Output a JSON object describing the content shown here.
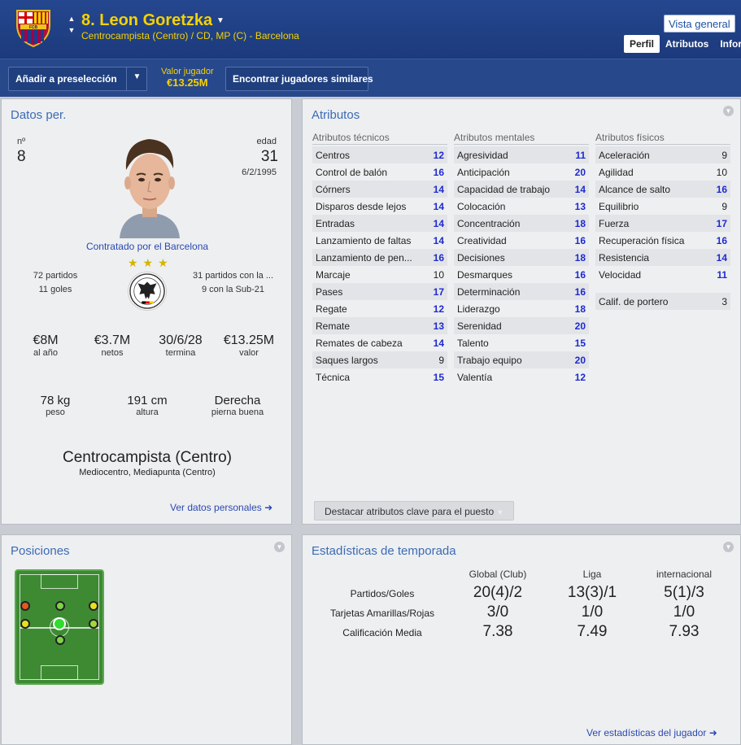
{
  "header": {
    "player_title": "8. Leon Goretzka",
    "subtitle": "Centrocampista (Centro) / CD, MP (C) - Barcelona",
    "overview_button": "Vista general",
    "tabs": [
      "Perfil",
      "Atributos",
      "Infor"
    ],
    "crest_text": "FCB"
  },
  "toolbar": {
    "shortlist_button": "Añadir a preselección",
    "value_label": "Valor jugador",
    "value_amount": "€13.25M",
    "similar_button": "Encontrar jugadores similares"
  },
  "personal": {
    "title": "Datos per.",
    "number_label": "nº",
    "number": "8",
    "age_label": "edad",
    "age": "31",
    "dob": "6/2/1995",
    "contract": "Contratado por el Barcelona",
    "club_apps": "72 partidos",
    "club_goals": "11 goles",
    "intl_apps": "31 partidos con la ...",
    "intl_u21": "9 con la Sub-21",
    "wage": "€8M",
    "wage_label": "al año",
    "net": "€3.7M",
    "net_label": "netos",
    "expiry": "30/6/28",
    "expiry_label": "termina",
    "value": "€13.25M",
    "value_label": "valor",
    "weight": "78 kg",
    "weight_label": "peso",
    "height": "191 cm",
    "height_label": "altura",
    "foot": "Derecha",
    "foot_label": "pierna buena",
    "position": "Centrocampista (Centro)",
    "position_sub": "Mediocentro, Mediapunta (Centro)",
    "link": "Ver datos personales"
  },
  "attributes": {
    "title": "Atributos",
    "technical": {
      "heading": "Atributos técnicos",
      "items": [
        {
          "name": "Centros",
          "value": "12"
        },
        {
          "name": "Control de balón",
          "value": "16"
        },
        {
          "name": "Córners",
          "value": "14"
        },
        {
          "name": "Disparos desde lejos",
          "value": "14"
        },
        {
          "name": "Entradas",
          "value": "14"
        },
        {
          "name": "Lanzamiento de faltas",
          "value": "14"
        },
        {
          "name": "Lanzamiento de pen...",
          "value": "16"
        },
        {
          "name": "Marcaje",
          "value": "10"
        },
        {
          "name": "Pases",
          "value": "17"
        },
        {
          "name": "Regate",
          "value": "12"
        },
        {
          "name": "Remate",
          "value": "13"
        },
        {
          "name": "Remates de cabeza",
          "value": "14"
        },
        {
          "name": "Saques largos",
          "value": "9"
        },
        {
          "name": "Técnica",
          "value": "15"
        }
      ]
    },
    "mental": {
      "heading": "Atributos mentales",
      "items": [
        {
          "name": "Agresividad",
          "value": "11"
        },
        {
          "name": "Anticipación",
          "value": "20"
        },
        {
          "name": "Capacidad de trabajo",
          "value": "14"
        },
        {
          "name": "Colocación",
          "value": "13"
        },
        {
          "name": "Concentración",
          "value": "18"
        },
        {
          "name": "Creatividad",
          "value": "16"
        },
        {
          "name": "Decisiones",
          "value": "18"
        },
        {
          "name": "Desmarques",
          "value": "16"
        },
        {
          "name": "Determinación",
          "value": "16"
        },
        {
          "name": "Liderazgo",
          "value": "18"
        },
        {
          "name": "Serenidad",
          "value": "20"
        },
        {
          "name": "Talento",
          "value": "15"
        },
        {
          "name": "Trabajo equipo",
          "value": "20"
        },
        {
          "name": "Valentía",
          "value": "12"
        }
      ]
    },
    "physical": {
      "heading": "Atributos físicos",
      "items": [
        {
          "name": "Aceleración",
          "value": "9"
        },
        {
          "name": "Agilidad",
          "value": "10"
        },
        {
          "name": "Alcance de salto",
          "value": "16"
        },
        {
          "name": "Equilibrio",
          "value": "9"
        },
        {
          "name": "Fuerza",
          "value": "17"
        },
        {
          "name": "Recuperación física",
          "value": "16"
        },
        {
          "name": "Resistencia",
          "value": "14"
        },
        {
          "name": "Velocidad",
          "value": "11"
        }
      ],
      "keeper_label": "Calif. de portero",
      "keeper_value": "3"
    },
    "highlight_button": "Destacar atributos clave para el puesto"
  },
  "positions": {
    "title": "Posiciones",
    "colors": {
      "natural": "#2fdc2f",
      "competent": "#d7e021",
      "unconvincing": "#e0a621",
      "awkward": "#e0541f",
      "accent": "#7ed24a"
    }
  },
  "season": {
    "title": "Estadísticas de temporada",
    "columns": [
      "Global (Club)",
      "Liga",
      "internacional"
    ],
    "rows": [
      {
        "label": "Partidos/Goles",
        "values": [
          "20(4)/2",
          "13(3)/1",
          "5(1)/3"
        ]
      },
      {
        "label": "Tarjetas Amarillas/Rojas",
        "values": [
          "3/0",
          "1/0",
          "1/0"
        ]
      },
      {
        "label": "Calificación Media",
        "values": [
          "7.38",
          "7.49",
          "7.93"
        ]
      }
    ],
    "link": "Ver estadísticas del jugador"
  }
}
